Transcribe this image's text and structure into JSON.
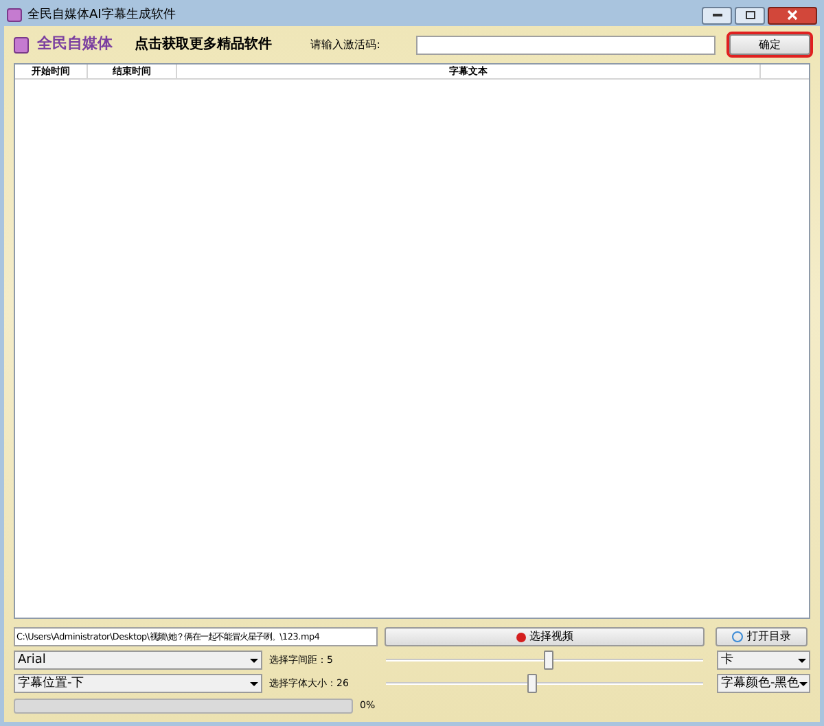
{
  "window": {
    "title": "全民自媒体AI字幕生成软件"
  },
  "header": {
    "brand": "全民自媒体",
    "promo_link": "点击获取更多精品软件",
    "activation_label": "请输入激活码:",
    "activation_button": "确定"
  },
  "table": {
    "columns": [
      "开始时间",
      "结束时间",
      "字幕文本"
    ]
  },
  "controls": {
    "file_path": "C:\\Users\\Administrator\\Desktop\\视频\\她？俩在一起不能冒火星子咧。\\123.mp4",
    "select_video_button": "选择视频",
    "open_folder_button": "打开目录",
    "font_select": "Arial",
    "spacing_label": "选择字间距：5",
    "spacing_slider": {
      "level": 0.51
    },
    "style_select": "卡",
    "position_select": "字幕位置-下",
    "size_label": "选择字体大小：26",
    "size_slider": {
      "level": 0.46
    },
    "color_select": "字幕颜色-黑色",
    "progress": {
      "reading": "0%"
    }
  }
}
